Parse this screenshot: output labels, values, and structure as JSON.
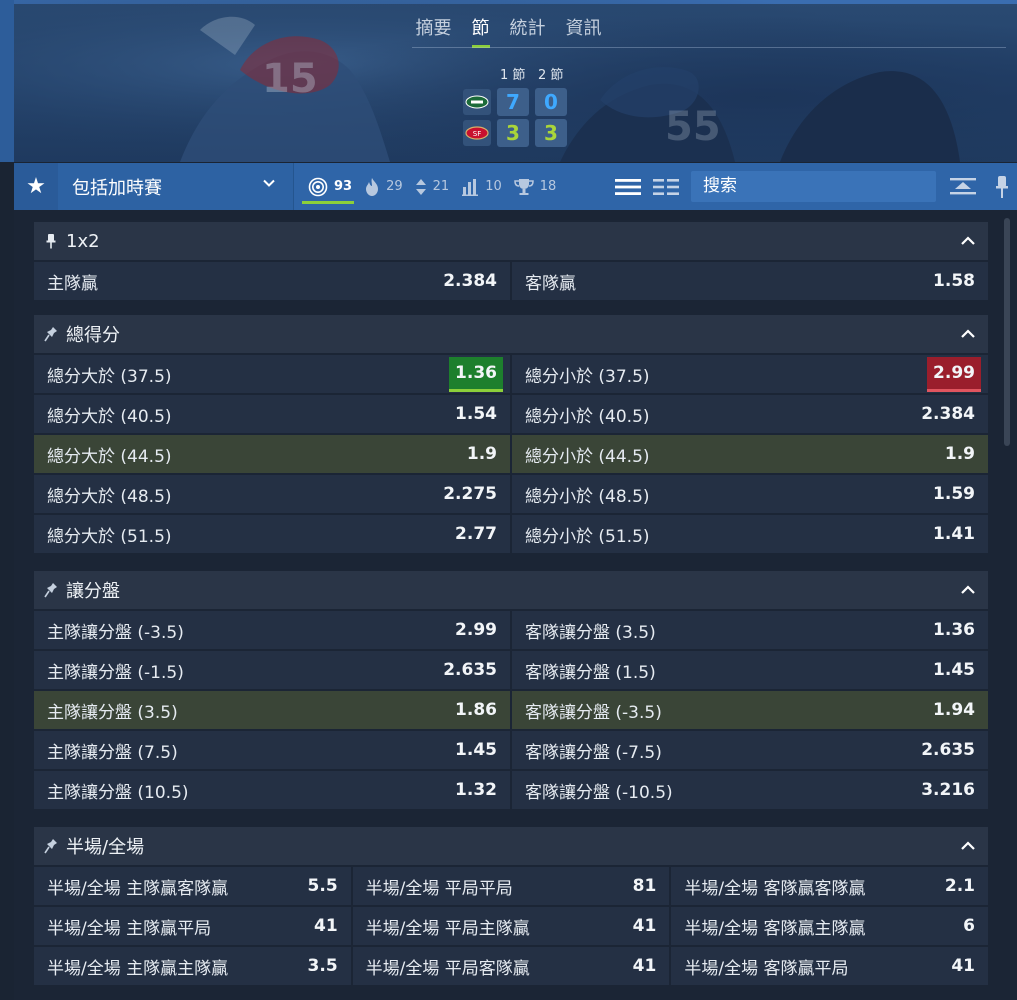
{
  "header": {
    "tabs": [
      {
        "label": "摘要",
        "active": false
      },
      {
        "label": "節",
        "active": true
      },
      {
        "label": "統計",
        "active": false
      },
      {
        "label": "資訊",
        "active": false
      }
    ],
    "periods": [
      "1 節",
      "2 節"
    ],
    "teams": [
      {
        "logo": "jets-logo-icon",
        "scores": [
          "7",
          "0"
        ],
        "color": "#3fa9ff"
      },
      {
        "logo": "49ers-logo-icon",
        "scores": [
          "3",
          "3"
        ],
        "color": "#a9d53a"
      }
    ]
  },
  "filterbar": {
    "select_label": "包括加時賽",
    "stats": [
      {
        "icon": "target-icon",
        "count": "93",
        "active": true
      },
      {
        "icon": "flame-icon",
        "count": "29"
      },
      {
        "icon": "up-down-icon",
        "count": "21"
      },
      {
        "icon": "bar-chart-icon",
        "count": "10"
      },
      {
        "icon": "trophy-icon",
        "count": "18"
      }
    ],
    "search_placeholder": "搜索"
  },
  "markets": [
    {
      "title": "1x2",
      "pinned": true,
      "rows": [
        {
          "highlight": false,
          "cells": [
            {
              "label": "主隊贏",
              "odd": "2.384"
            },
            {
              "label": "客隊贏",
              "odd": "1.58"
            }
          ]
        }
      ]
    },
    {
      "title": "總得分",
      "pinned": false,
      "rows": [
        {
          "highlight": false,
          "cells": [
            {
              "label": "總分大於 (37.5)",
              "odd": "1.36",
              "trend": "up"
            },
            {
              "label": "總分小於 (37.5)",
              "odd": "2.99",
              "trend": "down"
            }
          ]
        },
        {
          "highlight": false,
          "cells": [
            {
              "label": "總分大於 (40.5)",
              "odd": "1.54"
            },
            {
              "label": "總分小於 (40.5)",
              "odd": "2.384"
            }
          ]
        },
        {
          "highlight": true,
          "cells": [
            {
              "label": "總分大於 (44.5)",
              "odd": "1.9"
            },
            {
              "label": "總分小於 (44.5)",
              "odd": "1.9"
            }
          ]
        },
        {
          "highlight": false,
          "cells": [
            {
              "label": "總分大於 (48.5)",
              "odd": "2.275"
            },
            {
              "label": "總分小於 (48.5)",
              "odd": "1.59"
            }
          ]
        },
        {
          "highlight": false,
          "cells": [
            {
              "label": "總分大於 (51.5)",
              "odd": "2.77"
            },
            {
              "label": "總分小於 (51.5)",
              "odd": "1.41"
            }
          ]
        }
      ]
    },
    {
      "title": "讓分盤",
      "pinned": false,
      "rows": [
        {
          "highlight": false,
          "cells": [
            {
              "label": "主隊讓分盤 (-3.5)",
              "odd": "2.99"
            },
            {
              "label": "客隊讓分盤 (3.5)",
              "odd": "1.36"
            }
          ]
        },
        {
          "highlight": false,
          "cells": [
            {
              "label": "主隊讓分盤 (-1.5)",
              "odd": "2.635"
            },
            {
              "label": "客隊讓分盤 (1.5)",
              "odd": "1.45"
            }
          ]
        },
        {
          "highlight": true,
          "cells": [
            {
              "label": "主隊讓分盤 (3.5)",
              "odd": "1.86"
            },
            {
              "label": "客隊讓分盤 (-3.5)",
              "odd": "1.94"
            }
          ]
        },
        {
          "highlight": false,
          "cells": [
            {
              "label": "主隊讓分盤 (7.5)",
              "odd": "1.45"
            },
            {
              "label": "客隊讓分盤 (-7.5)",
              "odd": "2.635"
            }
          ]
        },
        {
          "highlight": false,
          "cells": [
            {
              "label": "主隊讓分盤 (10.5)",
              "odd": "1.32"
            },
            {
              "label": "客隊讓分盤 (-10.5)",
              "odd": "3.216"
            }
          ]
        }
      ]
    },
    {
      "title": "半場/全場",
      "pinned": false,
      "rows": [
        {
          "highlight": false,
          "cells": [
            {
              "label": "半場/全場 主隊贏客隊贏",
              "odd": "5.5"
            },
            {
              "label": "半場/全場 平局平局",
              "odd": "81"
            },
            {
              "label": "半場/全場 客隊贏客隊贏",
              "odd": "2.1"
            }
          ]
        },
        {
          "highlight": false,
          "cells": [
            {
              "label": "半場/全場 主隊贏平局",
              "odd": "41"
            },
            {
              "label": "半場/全場 平局主隊贏",
              "odd": "41"
            },
            {
              "label": "半場/全場 客隊贏主隊贏",
              "odd": "6"
            }
          ]
        },
        {
          "highlight": false,
          "cells": [
            {
              "label": "半場/全場 主隊贏主隊贏",
              "odd": "3.5"
            },
            {
              "label": "半場/全場 平局客隊贏",
              "odd": "41"
            },
            {
              "label": "半場/全場 客隊贏平局",
              "odd": "41"
            }
          ]
        }
      ]
    }
  ]
}
